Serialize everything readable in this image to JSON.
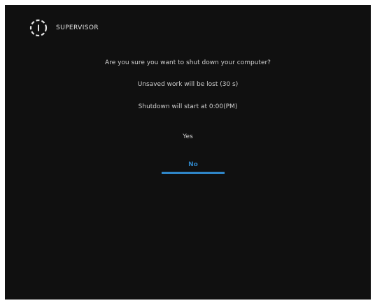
{
  "header": {
    "app_name": "SUPERVISOR",
    "logo_icon": "power-ring-icon"
  },
  "dialog": {
    "message_lines": [
      "Are you sure you want to shut down your computer?",
      "Unsaved work will be lost (30 s)",
      "Shutdown will start at 0:00(PM)"
    ],
    "options": [
      {
        "label": "Yes"
      },
      {
        "label": "No"
      }
    ],
    "selected_option": "No",
    "accent_color": "#2f86c8",
    "background_color": "#101010"
  }
}
